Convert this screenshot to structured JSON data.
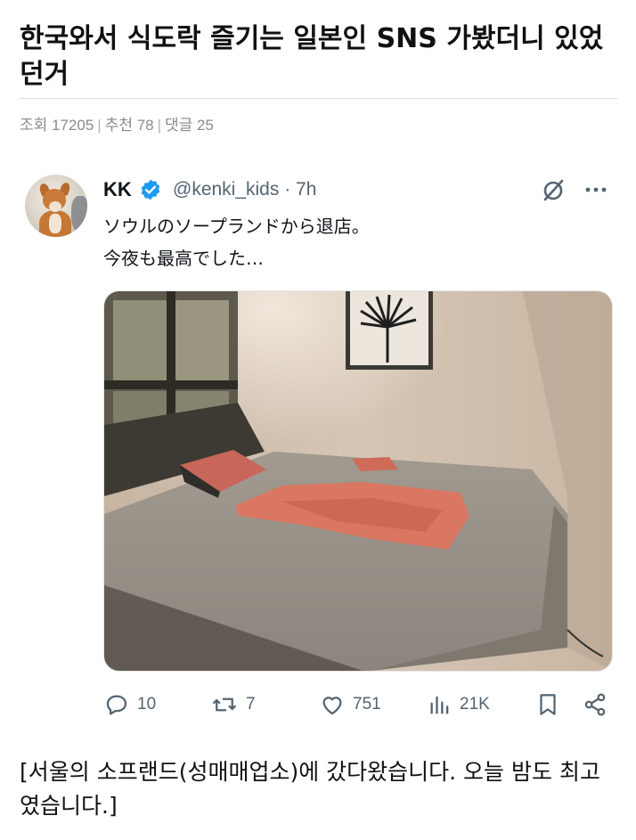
{
  "post": {
    "title": "한국와서 식도락 즐기는 일본인 SNS 가봤더니 있었던거",
    "meta": {
      "views": "조회 17205",
      "recommend": "추천 78",
      "comments": "댓글 25"
    }
  },
  "tweet": {
    "name": "KK",
    "handle": "@kenki_kids · 7h",
    "lines": [
      "ソウルのソープランドから退店。",
      "今夜も最高でした…"
    ],
    "replies": "10",
    "retweets": "7",
    "likes": "751",
    "views": "21K"
  },
  "caption": "[서울의 소프랜드(성매매업소)에 갔다왔습니다. 오늘 밤도 최고였습니다.]",
  "colors": {
    "verified": "#1d9bf0",
    "muted": "#536471"
  },
  "icons": [
    "verified-badge-icon",
    "grok-icon",
    "more-icon",
    "reply-icon",
    "retweet-icon",
    "like-icon",
    "views-icon",
    "bookmark-icon",
    "share-icon"
  ]
}
